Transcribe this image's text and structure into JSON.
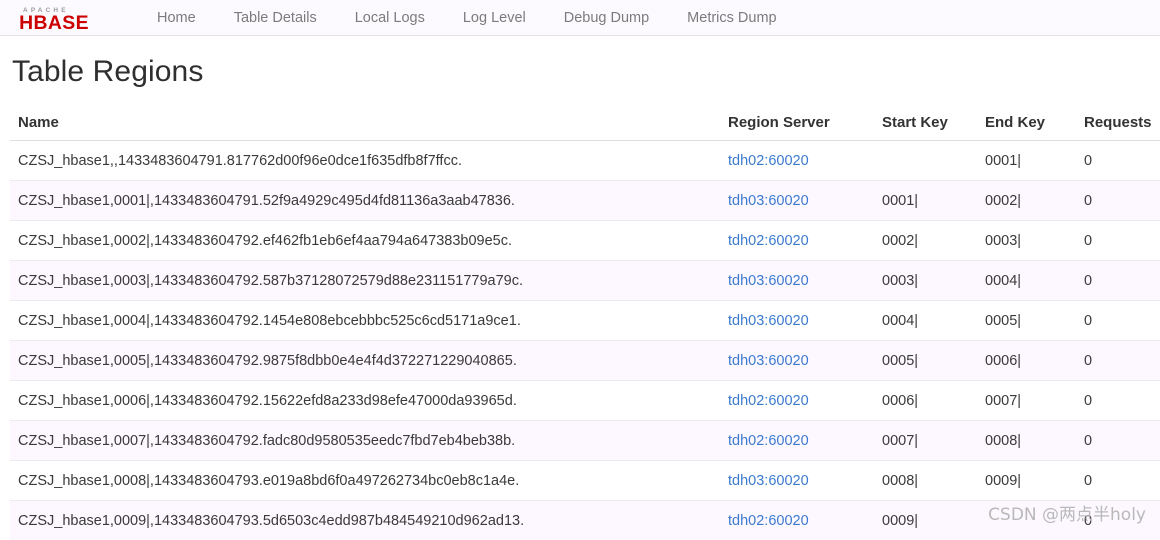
{
  "navbar": {
    "logo": {
      "icon": "hbase-logo",
      "top_text": "A P A C H E",
      "main_text": "HBASE",
      "color_main": "#cc0000",
      "color_top": "#999999"
    },
    "links": [
      {
        "label": "Home",
        "name": "nav-home"
      },
      {
        "label": "Table Details",
        "name": "nav-table-details"
      },
      {
        "label": "Local Logs",
        "name": "nav-local-logs"
      },
      {
        "label": "Log Level",
        "name": "nav-log-level"
      },
      {
        "label": "Debug Dump",
        "name": "nav-debug-dump"
      },
      {
        "label": "Metrics Dump",
        "name": "nav-metrics-dump"
      }
    ]
  },
  "page": {
    "title": "Table Regions"
  },
  "table": {
    "headers": {
      "name": "Name",
      "region_server": "Region Server",
      "start_key": "Start Key",
      "end_key": "End Key",
      "requests": "Requests"
    },
    "rows": [
      {
        "name": "CZSJ_hbase1,,1433483604791.817762d00f96e0dce1f635dfb8f7ffcc.",
        "region_server": "tdh02:60020",
        "start_key": "",
        "end_key": "0001|",
        "requests": "0"
      },
      {
        "name": "CZSJ_hbase1,0001|,1433483604791.52f9a4929c495d4fd81136a3aab47836.",
        "region_server": "tdh03:60020",
        "start_key": "0001|",
        "end_key": "0002|",
        "requests": "0"
      },
      {
        "name": "CZSJ_hbase1,0002|,1433483604792.ef462fb1eb6ef4aa794a647383b09e5c.",
        "region_server": "tdh02:60020",
        "start_key": "0002|",
        "end_key": "0003|",
        "requests": "0"
      },
      {
        "name": "CZSJ_hbase1,0003|,1433483604792.587b37128072579d88e231151779a79c.",
        "region_server": "tdh03:60020",
        "start_key": "0003|",
        "end_key": "0004|",
        "requests": "0"
      },
      {
        "name": "CZSJ_hbase1,0004|,1433483604792.1454e808ebcebbbc525c6cd5171a9ce1.",
        "region_server": "tdh03:60020",
        "start_key": "0004|",
        "end_key": "0005|",
        "requests": "0"
      },
      {
        "name": "CZSJ_hbase1,0005|,1433483604792.9875f8dbb0e4e4f4d372271229040865.",
        "region_server": "tdh03:60020",
        "start_key": "0005|",
        "end_key": "0006|",
        "requests": "0"
      },
      {
        "name": "CZSJ_hbase1,0006|,1433483604792.15622efd8a233d98efe47000da93965d.",
        "region_server": "tdh02:60020",
        "start_key": "0006|",
        "end_key": "0007|",
        "requests": "0"
      },
      {
        "name": "CZSJ_hbase1,0007|,1433483604792.fadc80d9580535eedc7fbd7eb4beb38b.",
        "region_server": "tdh02:60020",
        "start_key": "0007|",
        "end_key": "0008|",
        "requests": "0"
      },
      {
        "name": "CZSJ_hbase1,0008|,1433483604793.e019a8bd6f0a497262734bc0eb8c1a4e.",
        "region_server": "tdh03:60020",
        "start_key": "0008|",
        "end_key": "0009|",
        "requests": "0"
      },
      {
        "name": "CZSJ_hbase1,0009|,1433483604793.5d6503c4edd987b484549210d962ad13.",
        "region_server": "tdh02:60020",
        "start_key": "0009|",
        "end_key": "",
        "requests": "0"
      }
    ]
  },
  "watermark": {
    "text": "CSDN @两点半holy"
  }
}
